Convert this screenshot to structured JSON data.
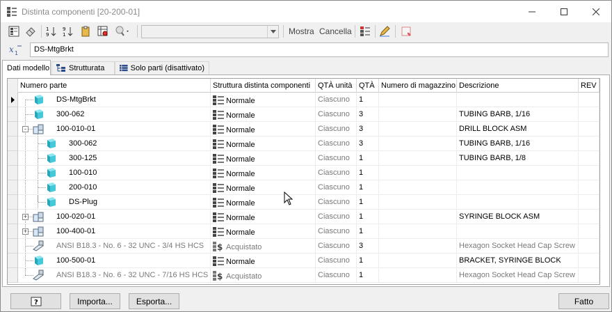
{
  "window": {
    "title": "Distinta componenti [20-200-01]"
  },
  "toolbar": {
    "combo_value": "",
    "show_label": "Mostra",
    "cancel_label": "Cancella"
  },
  "part_number": {
    "value": "DS-MtgBrkt"
  },
  "tabs": [
    {
      "label": "Dati modello"
    },
    {
      "label": "Strutturata"
    },
    {
      "label": "Solo parti (disattivato)"
    }
  ],
  "grid": {
    "columns": [
      "Numero parte",
      "Struttura distinta componenti",
      "QTÀ unità",
      "QTÀ",
      "Numero di magazzino",
      "Descrizione",
      "REV"
    ],
    "rows": [
      {
        "part": "DS-MtgBrkt",
        "structure": "Normale",
        "unit": "Ciascuno",
        "qty": "1",
        "stock": "",
        "desc": "",
        "rev": ""
      },
      {
        "part": "300-062",
        "structure": "Normale",
        "unit": "Ciascuno",
        "qty": "3",
        "stock": "",
        "desc": "TUBING BARB, 1/16",
        "rev": ""
      },
      {
        "part": "100-010-01",
        "structure": "Normale",
        "unit": "Ciascuno",
        "qty": "3",
        "stock": "",
        "desc": "DRILL BLOCK ASM",
        "rev": ""
      },
      {
        "part": "300-062",
        "structure": "Normale",
        "unit": "Ciascuno",
        "qty": "3",
        "stock": "",
        "desc": "TUBING BARB, 1/16",
        "rev": ""
      },
      {
        "part": "300-125",
        "structure": "Normale",
        "unit": "Ciascuno",
        "qty": "1",
        "stock": "",
        "desc": "TUBING BARB, 1/8",
        "rev": ""
      },
      {
        "part": "100-010",
        "structure": "Normale",
        "unit": "Ciascuno",
        "qty": "1",
        "stock": "",
        "desc": "",
        "rev": ""
      },
      {
        "part": "200-010",
        "structure": "Normale",
        "unit": "Ciascuno",
        "qty": "1",
        "stock": "",
        "desc": "",
        "rev": ""
      },
      {
        "part": "DS-Plug",
        "structure": "Normale",
        "unit": "Ciascuno",
        "qty": "1",
        "stock": "",
        "desc": "",
        "rev": ""
      },
      {
        "part": "100-020-01",
        "structure": "Normale",
        "unit": "Ciascuno",
        "qty": "1",
        "stock": "",
        "desc": "SYRINGE BLOCK ASM",
        "rev": ""
      },
      {
        "part": "100-400-01",
        "structure": "Normale",
        "unit": "Ciascuno",
        "qty": "1",
        "stock": "",
        "desc": "",
        "rev": ""
      },
      {
        "part": "ANSI B18.3 - No. 6 - 32 UNC - 3/4 HS HCS",
        "structure": "Acquistato",
        "unit": "Ciascuno",
        "qty": "3",
        "stock": "",
        "desc": "Hexagon Socket Head Cap Screw",
        "rev": ""
      },
      {
        "part": "100-500-01",
        "structure": "Normale",
        "unit": "Ciascuno",
        "qty": "1",
        "stock": "",
        "desc": "BRACKET, SYRINGE BLOCK",
        "rev": ""
      },
      {
        "part": "ANSI B18.3 - No. 6 - 32 UNC - 7/16 HS HCS",
        "structure": "Acquistato",
        "unit": "Ciascuno",
        "qty": "1",
        "stock": "",
        "desc": "Hexagon Socket Head Cap Screw",
        "rev": ""
      }
    ]
  },
  "buttons": {
    "import_label": "Importa...",
    "export_label": "Esporta...",
    "done_label": "Fatto"
  },
  "colors": {
    "part_cyan": "#3fc6d6",
    "folder_yellow": "#e8b84a",
    "disabled_text": "#7a7a7a"
  }
}
